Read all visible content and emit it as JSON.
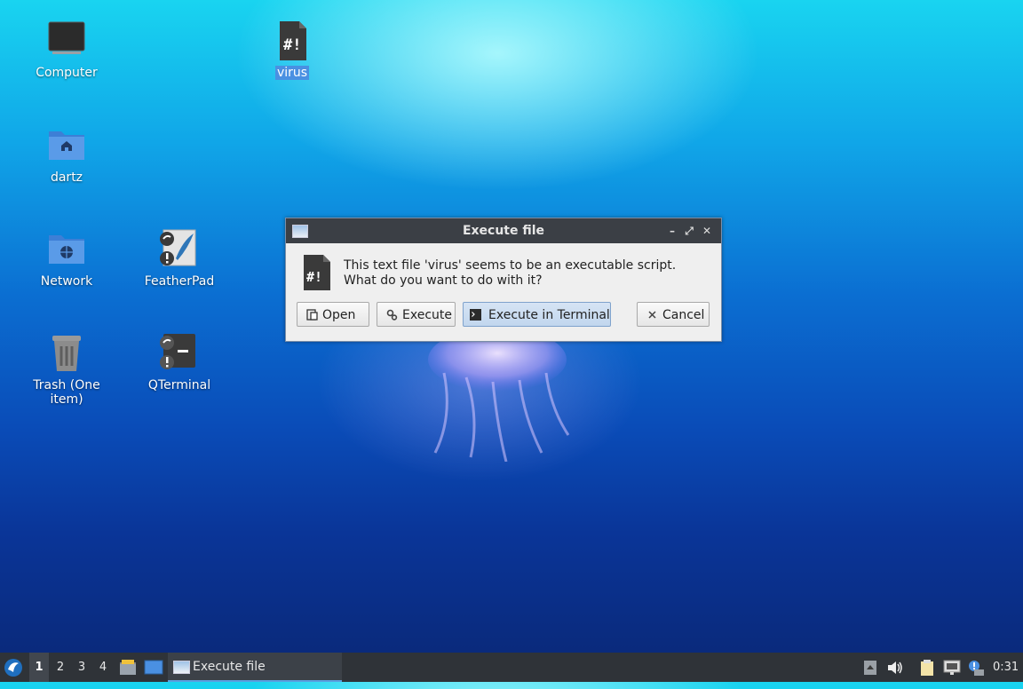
{
  "desktop": {
    "icons": [
      {
        "label": "Computer",
        "icon": "computer-icon"
      },
      {
        "label": "virus",
        "icon": "script-file-icon"
      },
      {
        "label": "dartz",
        "icon": "home-folder-icon"
      },
      {
        "label": "Network",
        "icon": "network-folder-icon"
      },
      {
        "label": "FeatherPad",
        "icon": "featherpad-icon"
      },
      {
        "label": "Trash (One item)",
        "icon": "trash-icon"
      },
      {
        "label": "QTerminal",
        "icon": "terminal-icon"
      }
    ]
  },
  "dialog": {
    "title": "Execute file",
    "line1": "This text file 'virus' seems to be an executable script.",
    "line2": "What do you want to do with it?",
    "buttons": {
      "open": "Open",
      "execute": "Execute",
      "execute_terminal": "Execute in Terminal",
      "cancel": "Cancel"
    },
    "controls": {
      "minimize": "–",
      "maximize": "⤢",
      "close": "✕"
    }
  },
  "taskbar": {
    "workspaces": [
      "1",
      "2",
      "3",
      "4"
    ],
    "active_workspace": "1",
    "task": "Execute file",
    "clock": "0:31"
  },
  "colors": {
    "selection": "#4a90e2",
    "titlebar": "#3b3f45",
    "taskbar": "#2f3338"
  }
}
